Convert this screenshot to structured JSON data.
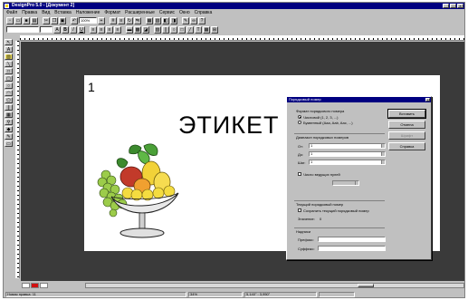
{
  "window": {
    "title": "DesignPro 5.0 - [Документ 2]"
  },
  "menu": [
    "Файл",
    "Правка",
    "Вид",
    "Вставка",
    "Наложение",
    "Формат",
    "Расширенные",
    "Сервис",
    "Окно",
    "Справка"
  ],
  "toolbar": {
    "font_size": "100%"
  },
  "page": {
    "number": "1",
    "heading": "ЭТИКЕТ"
  },
  "dialog": {
    "title": "Порядковый номер",
    "format_label": "Формат порядкового номера",
    "option_numbers": "Числовой (1, 2, 3, ...)",
    "option_letters": "Буквенный (Aaa, Aab, Aac, ...)",
    "range_label": "Диапазон порядковых номеров",
    "from_label": "От:",
    "to_label": "До:",
    "step_label": "Шаг:",
    "from_value": "1",
    "to_value": "1",
    "step_value": "1",
    "leading_zeros_label": "Число ведущих нулей",
    "current_label": "Текущий порядковый номер",
    "save_current_label": "Сохранить текущий порядковый номер",
    "value_label": "Значение:",
    "value": "0",
    "labels_label": "Надписи",
    "prefix_label": "Префикс:",
    "suffix_label": "Суффикс:",
    "ok": "Вставить",
    "cancel": "Отмена",
    "disabled": "Шрифт",
    "help": "Справка"
  },
  "statusbar": {
    "hint": "Новая правка: 11",
    "zoom": "34%",
    "coords": "5,140\" : 3,950\""
  },
  "colors": {
    "titlebar": "#000080",
    "canvas": "#3a3a3a",
    "chrome": "#c0c0c0"
  }
}
